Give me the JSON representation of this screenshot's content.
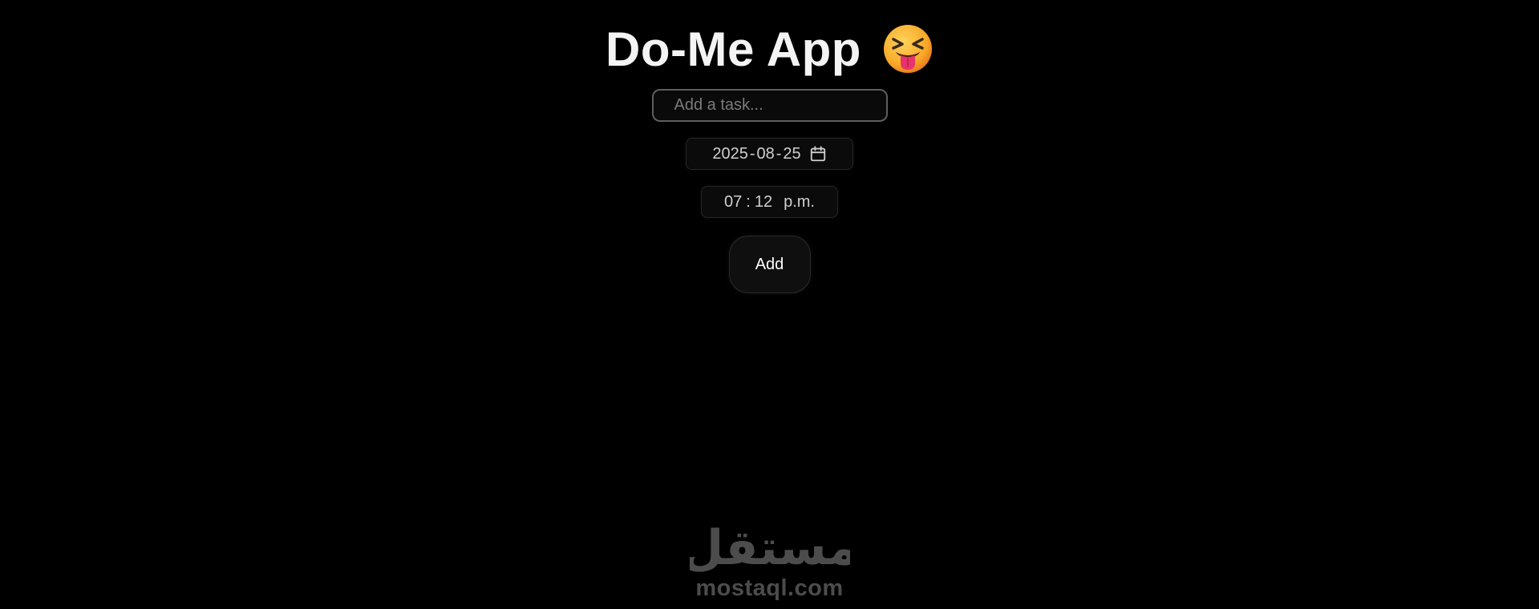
{
  "app": {
    "title": "Do-Me App",
    "title_icon": "squinting-face-with-tongue-icon"
  },
  "task_input": {
    "placeholder": "Add a task...",
    "value": ""
  },
  "date_field": {
    "year": "2025",
    "month": "08",
    "day": "25",
    "separator": "-",
    "icon": "calendar-icon"
  },
  "time_field": {
    "hour": "07",
    "minute": "12",
    "separator": ":",
    "period": "p.m."
  },
  "add_button": {
    "label": "Add"
  },
  "watermark": {
    "logo_text": "مستقل",
    "text": "mostaql.com"
  },
  "colors": {
    "background": "#000000",
    "title": "#f4f4f4",
    "input_border": "#5e5e5e",
    "field_text": "#cfcfcf",
    "emoji_face": "#f5a623",
    "emoji_tongue": "#e8336b"
  }
}
